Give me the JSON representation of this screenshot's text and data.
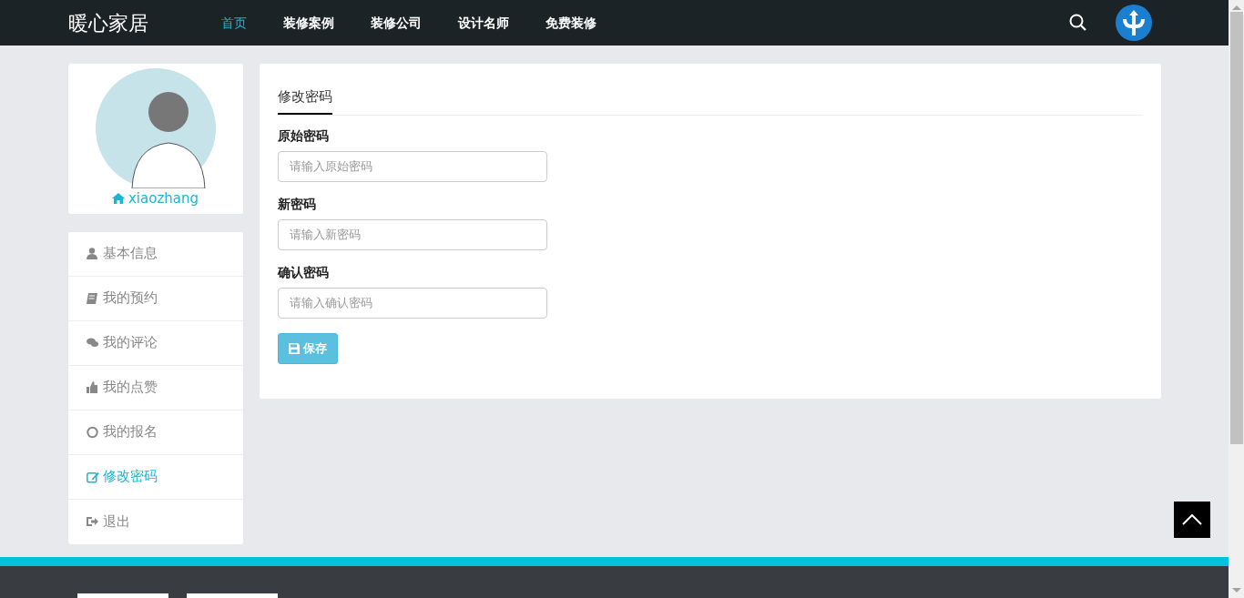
{
  "navbar": {
    "brand": "暖心家居",
    "items": [
      {
        "label": "首页",
        "selected": true
      },
      {
        "label": "装修案例",
        "selected": false
      },
      {
        "label": "装修公司",
        "selected": false
      },
      {
        "label": "设计名师",
        "selected": false
      },
      {
        "label": "免费装修",
        "selected": false
      }
    ]
  },
  "profile": {
    "username": "xiaozhang"
  },
  "sidebar": {
    "items": [
      {
        "label": "基本信息",
        "selected": false
      },
      {
        "label": "我的预约",
        "selected": false
      },
      {
        "label": "我的评论",
        "selected": false
      },
      {
        "label": "我的点赞",
        "selected": false
      },
      {
        "label": "我的报名",
        "selected": false
      },
      {
        "label": "修改密码",
        "selected": true
      },
      {
        "label": "退出",
        "selected": false
      }
    ]
  },
  "panel": {
    "tab": "修改密码",
    "fields": [
      {
        "label": "原始密码",
        "placeholder": "请输入原始密码"
      },
      {
        "label": "新密码",
        "placeholder": "请输入新密码"
      },
      {
        "label": "确认密码",
        "placeholder": "请输入确认密码"
      }
    ],
    "save_button": "保存"
  }
}
